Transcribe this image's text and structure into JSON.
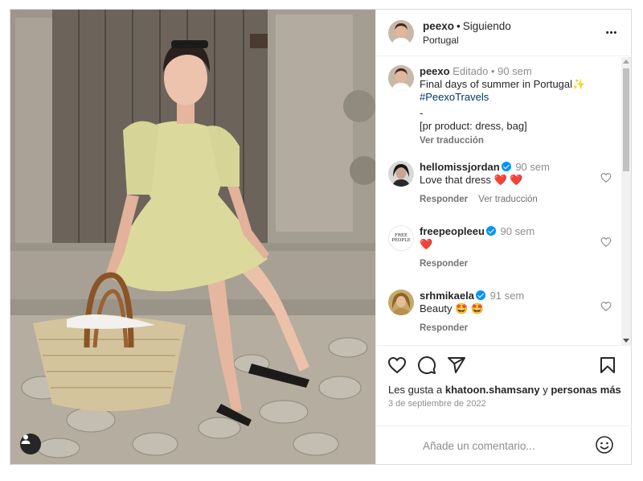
{
  "post": {
    "username": "peexo",
    "separator": "•",
    "follow_status": "Siguiendo",
    "location": "Portugal",
    "more_label": "•••"
  },
  "caption": {
    "author": "peexo",
    "edited": "Editado",
    "separator": "•",
    "time": "90 sem",
    "text": "Final days of summer in Portugal",
    "emoji": "✨",
    "hashtag": "#PeexoTravels",
    "dash": "-",
    "product": "[pr product: dress, bag]",
    "translate": "Ver traducción"
  },
  "comments": [
    {
      "author": "hellomissjordan",
      "verified": true,
      "time": "90 sem",
      "text": "Love that dress",
      "emoji": "❤️ ❤️",
      "reply": "Responder",
      "translate": "Ver traducción"
    },
    {
      "author": "freepeopleeu",
      "verified": true,
      "time": "90 sem",
      "text": "",
      "emoji": "❤️",
      "reply": "Responder"
    },
    {
      "author": "srhmikaela",
      "verified": true,
      "time": "91 sem",
      "text": "Beauty",
      "emoji": "🤩 🤩",
      "reply": "Responder"
    }
  ],
  "likes": {
    "prefix": "Les gusta a",
    "user": "khatoon.shamsany",
    "middle": "y",
    "suffix": "personas más"
  },
  "date": "3 de septiembre de 2022",
  "comment_input": {
    "placeholder": "Añade un comentario..."
  },
  "colors": {
    "link": "#00376b",
    "verified": "#0095f6",
    "heart": "#ed4956",
    "muted": "#8e8e8e"
  },
  "icons": [
    "heart-icon",
    "comment-icon",
    "share-icon",
    "bookmark-icon",
    "emoji-icon",
    "user-tag-icon",
    "more-icon"
  ]
}
